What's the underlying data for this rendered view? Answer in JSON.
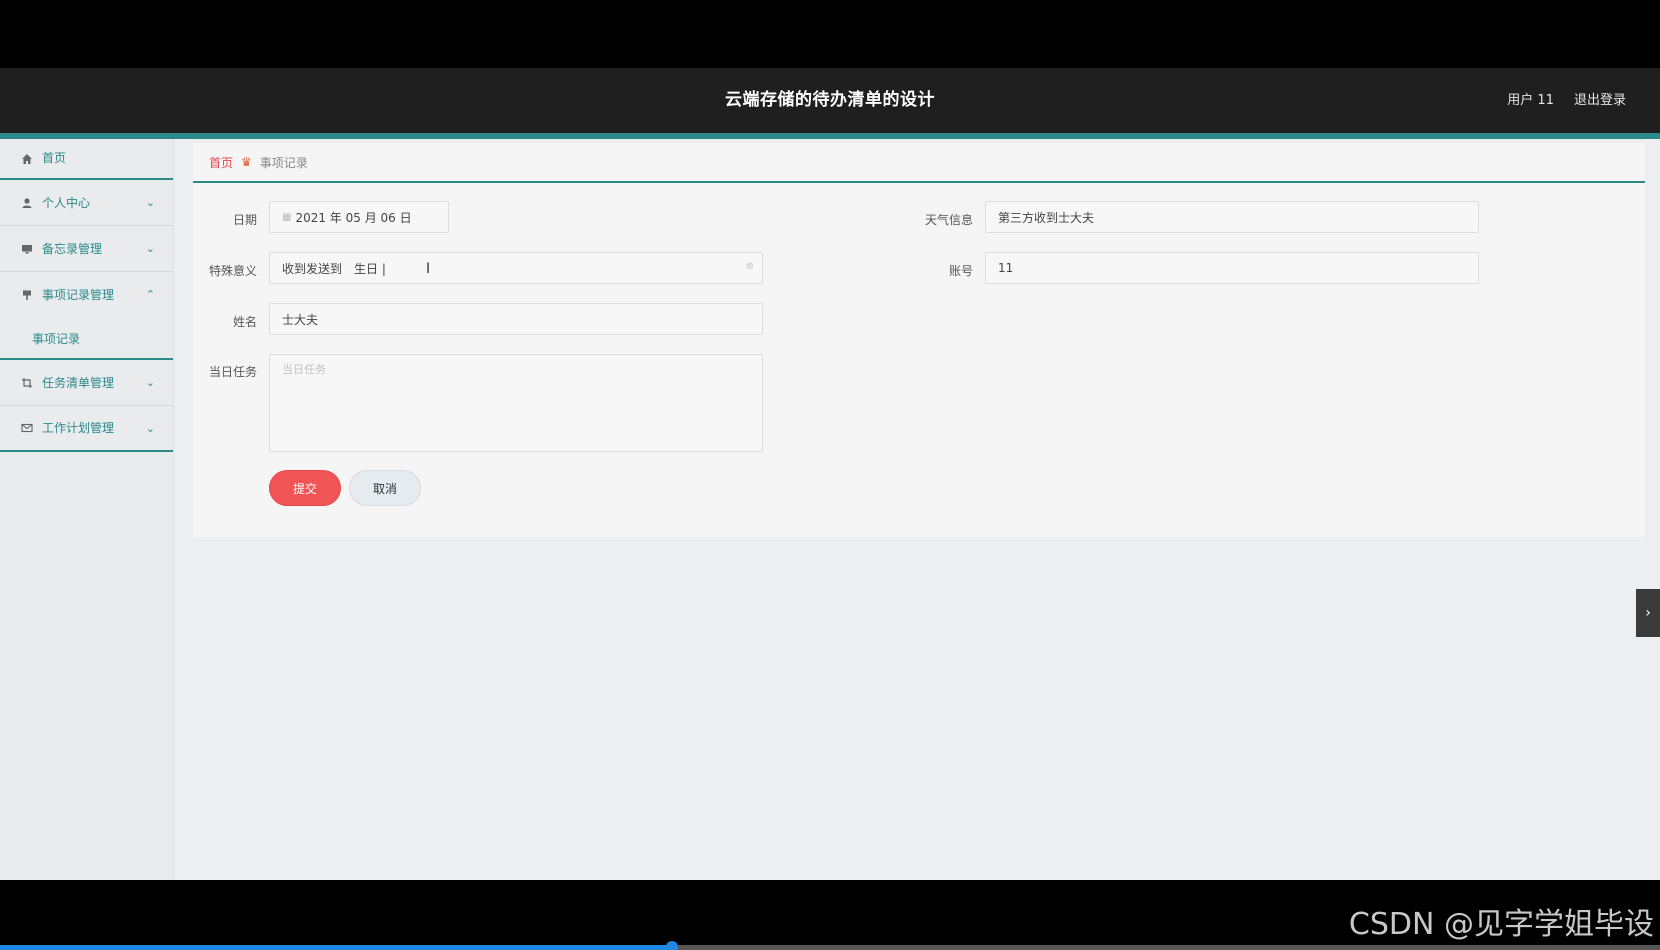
{
  "header": {
    "title": "云端存储的待办清单的设计",
    "user": "用户 11",
    "logout": "退出登录"
  },
  "sidebar": {
    "items": [
      {
        "label": "首页",
        "icon": "home-icon"
      },
      {
        "label": "个人中心",
        "icon": "user-icon"
      },
      {
        "label": "备忘录管理",
        "icon": "monitor-icon"
      },
      {
        "label": "事项记录管理",
        "icon": "pin-icon"
      },
      {
        "label": "任务清单管理",
        "icon": "crop-icon"
      },
      {
        "label": "工作计划管理",
        "icon": "mail-icon"
      }
    ],
    "sub_item": "事项记录"
  },
  "breadcrumb": {
    "home": "首页",
    "current": "事项记录"
  },
  "form": {
    "date_label": "日期",
    "date_value": "2021 年 05 月 06 日",
    "weather_label": "天气信息",
    "weather_value": "第三方收到士大夫",
    "special_label": "特殊意义",
    "special_value": "收到发送到　生日 |",
    "account_label": "账号",
    "account_value": "11",
    "name_label": "姓名",
    "name_value": "士大夫",
    "task_label": "当日任务",
    "task_placeholder": "当日任务",
    "submit_label": "提交",
    "cancel_label": "取消"
  },
  "watermark": "CSDN @见字学姐毕设",
  "progress": {
    "fraction": 0.405
  },
  "colors": {
    "accent": "#2a8a8a",
    "danger": "#f05454",
    "header_bg": "#1f1f1f"
  }
}
